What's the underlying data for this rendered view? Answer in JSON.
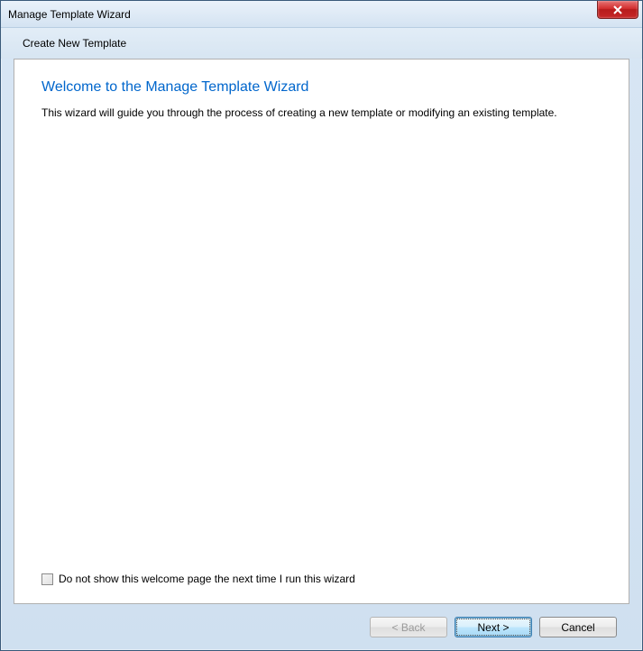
{
  "titlebar": {
    "title": "Manage Template Wizard"
  },
  "subheader": {
    "text": "Create New Template"
  },
  "content": {
    "welcome_title": "Welcome to the Manage Template Wizard",
    "welcome_text": "This wizard will guide you through the process of creating a new template or modifying an existing template.",
    "checkbox_label": "Do not show this welcome page the next time I run this wizard"
  },
  "buttons": {
    "back": "< Back",
    "next": "Next >",
    "cancel": "Cancel"
  }
}
